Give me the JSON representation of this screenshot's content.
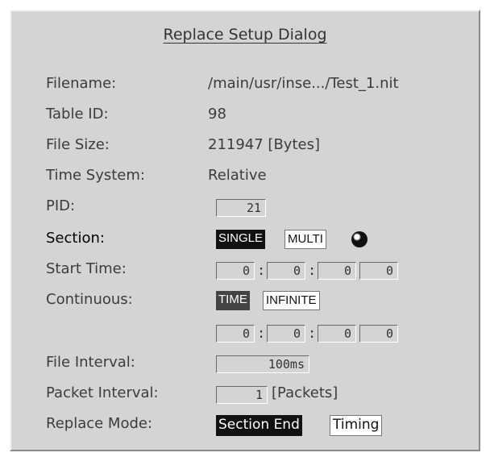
{
  "dialog": {
    "title": "Replace Setup Dialog"
  },
  "fields": {
    "filename": {
      "label": "Filename:",
      "value": "/main/usr/inse.../Test_1.nit"
    },
    "table_id": {
      "label": "Table ID:",
      "value": "98"
    },
    "file_size": {
      "label": "File Size:",
      "value": "211947 [Bytes]"
    },
    "time_system": {
      "label": "Time System:",
      "value": "Relative"
    },
    "pid": {
      "label": "PID:",
      "value": "21"
    },
    "section": {
      "label": "Section:",
      "options": [
        "SINGLE",
        "MULTI"
      ],
      "selected": "SINGLE"
    },
    "start_time": {
      "label": "Start Time:",
      "values": [
        "0",
        "0",
        "0",
        "0"
      ],
      "separator": ":"
    },
    "continuous": {
      "label": "Continuous:",
      "options": [
        "TIME",
        "INFINITE"
      ],
      "selected": "TIME",
      "values": [
        "0",
        "0",
        "0",
        "0"
      ],
      "separator": ":"
    },
    "file_interval": {
      "label": "File Interval:",
      "value": "100ms"
    },
    "packet_interval": {
      "label": "Packet Interval:",
      "value": "1",
      "unit": "[Packets]"
    },
    "replace_mode": {
      "label": "Replace Mode:",
      "options": [
        "Section End",
        "Timing"
      ],
      "selected": "Section End"
    }
  }
}
